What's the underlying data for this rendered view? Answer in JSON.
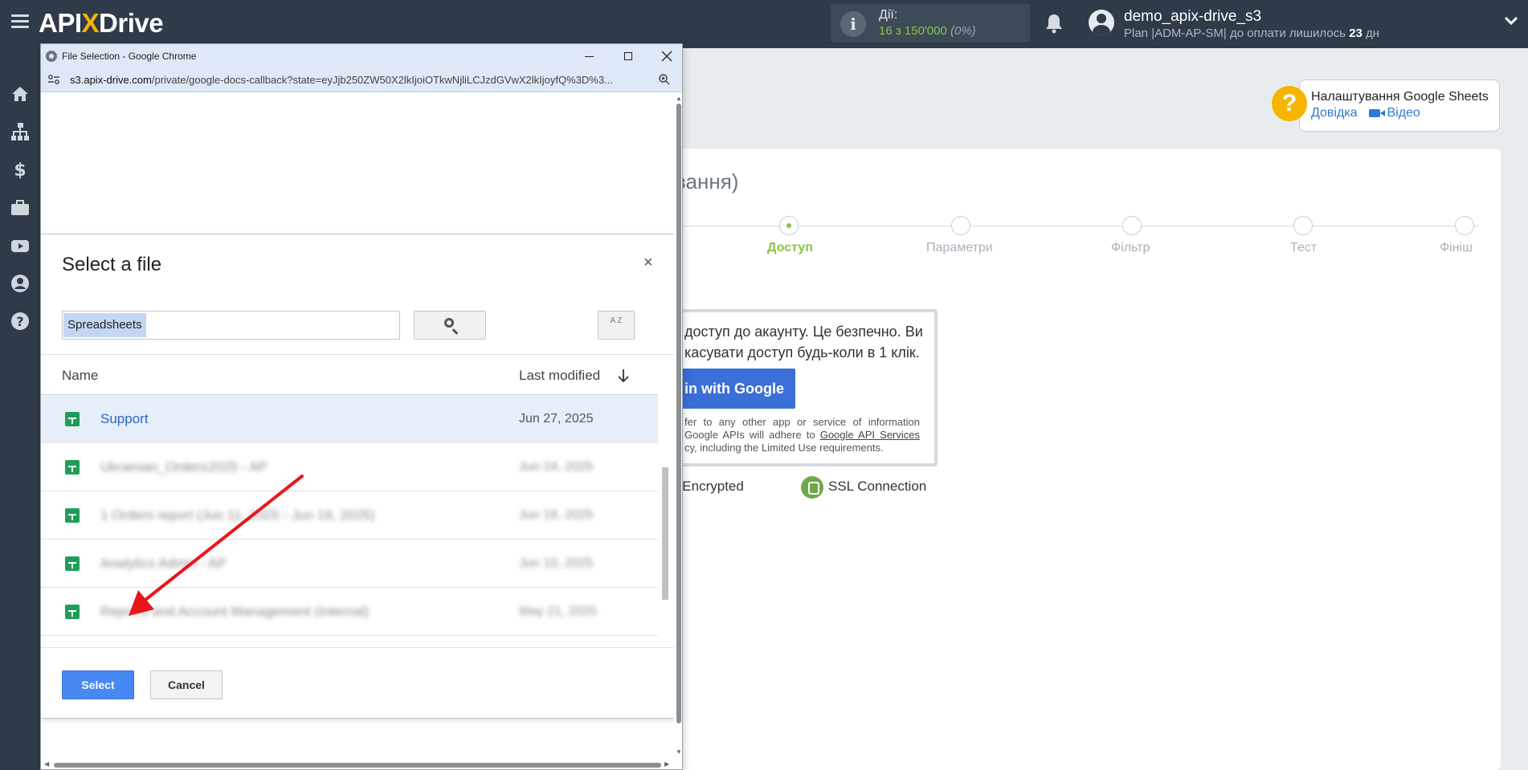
{
  "topbar": {
    "logo_prefix": "API",
    "logo_x": "X",
    "logo_suffix": "Drive",
    "actions_label": "Дії:",
    "actions_value": "16 з 150'000",
    "actions_pct": "(0%)",
    "username": "demo_apix-drive_s3",
    "plan_prefix": "Plan |ADM-AP-SM| до оплати лишилось ",
    "plan_days": "23",
    "plan_suffix": " дн"
  },
  "sidebar": {
    "icons": [
      "home-icon",
      "sitemap-icon",
      "dollar-icon",
      "briefcase-icon",
      "youtube-icon",
      "user-icon",
      "help-icon"
    ]
  },
  "help": {
    "title": "Налаштування Google Sheets",
    "link_help": "Довідка",
    "link_video": "Відео"
  },
  "main": {
    "step_title": "вання)",
    "steps": [
      "Доступ",
      "Параметри",
      "Фільтр",
      "Тест",
      "Фініш"
    ],
    "active_step": "Доступ",
    "signin_text": "доступ до акаунту. Це безпечно. Ви касувати доступ будь-коли в 1 клік.",
    "google_btn": "n in with Google",
    "small_text_a": "fer to any other app or service of information Google APIs will adhere to ",
    "small_text_link": "Google API Services",
    "small_text_b": "cy, including the Limited Use requirements.",
    "encrypted": "ord Encrypted",
    "ssl": "SSL Connection"
  },
  "chrome": {
    "title": "File Selection - Google Chrome",
    "url_host": "s3.apix-drive.com",
    "url_path": "/private/google-docs-callback?state=eyJjb250ZW50X2lkIjoiOTkwNjliLCJzdGVwX2lkIjoyfQ%3D%3..."
  },
  "picker": {
    "title": "Select a file",
    "close": "×",
    "search_value": "Spreadsheets",
    "sort_label": "A Z",
    "col_name": "Name",
    "col_modified": "Last modified",
    "rows": [
      {
        "name": "Support",
        "date": "Jun 27, 2025"
      },
      {
        "name": "Ukrainian_Orders2025 - AP",
        "date": "Jun 24, 2025"
      },
      {
        "name": "1 Orders report (Jun 11, 2025 - Jun 18, 2025)",
        "date": "Jun 18, 2025"
      },
      {
        "name": "Analytics Admin - AP",
        "date": "Jun 10, 2025"
      },
      {
        "name": "Reports and Account Management (Internal)",
        "date": "May 21, 2025"
      }
    ],
    "select_btn": "Select",
    "cancel_btn": "Cancel"
  },
  "colors": {
    "topbar": "#2f3b48",
    "accent_green": "#8bc34a",
    "logo_yellow": "#f5b400",
    "google_blue": "#3b6fd8",
    "select_blue": "#4788f2",
    "annotation_red": "#e8161b"
  }
}
